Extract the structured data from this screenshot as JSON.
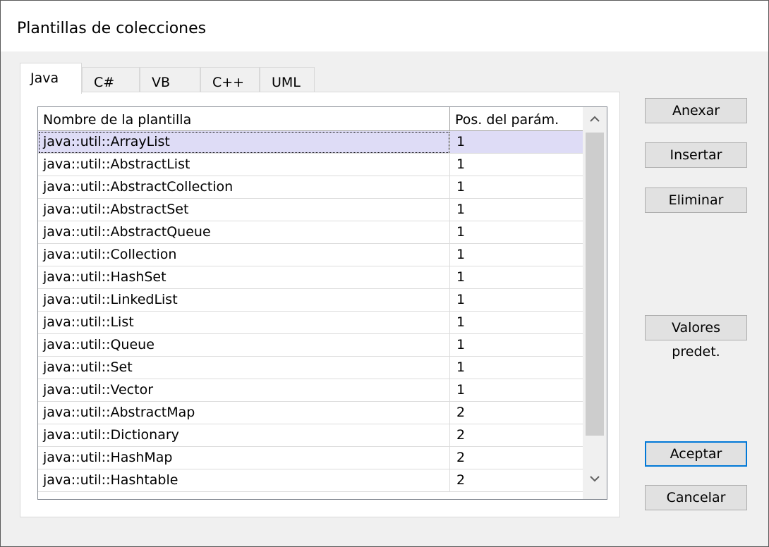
{
  "dialog": {
    "title": "Plantillas de colecciones"
  },
  "tabs": [
    "Java",
    "C#",
    "VB",
    "C++",
    "UML"
  ],
  "table": {
    "headers": [
      "Nombre de la plantilla",
      "Pos. del parám."
    ],
    "rows": [
      [
        "java::util::ArrayList",
        "1"
      ],
      [
        "java::util::AbstractList",
        "1"
      ],
      [
        "java::util::AbstractCollection",
        "1"
      ],
      [
        "java::util::AbstractSet",
        "1"
      ],
      [
        "java::util::AbstractQueue",
        "1"
      ],
      [
        "java::util::Collection",
        "1"
      ],
      [
        "java::util::HashSet",
        "1"
      ],
      [
        "java::util::LinkedList",
        "1"
      ],
      [
        "java::util::List",
        "1"
      ],
      [
        "java::util::Queue",
        "1"
      ],
      [
        "java::util::Set",
        "1"
      ],
      [
        "java::util::Vector",
        "1"
      ],
      [
        "java::util::AbstractMap",
        "2"
      ],
      [
        "java::util::Dictionary",
        "2"
      ],
      [
        "java::util::HashMap",
        "2"
      ],
      [
        "java::util::Hashtable",
        "2"
      ]
    ]
  },
  "buttons": {
    "append": "Anexar",
    "insert": "Insertar",
    "delete": "Eliminar",
    "defaults": "Valores predet.",
    "ok": "Aceptar",
    "cancel": "Cancelar"
  },
  "icons": {
    "scroll_up": "chevron-up-icon",
    "scroll_down": "chevron-down-icon"
  },
  "colors": {
    "selection": "#dedcf6",
    "default_button_border": "#0078d7"
  }
}
